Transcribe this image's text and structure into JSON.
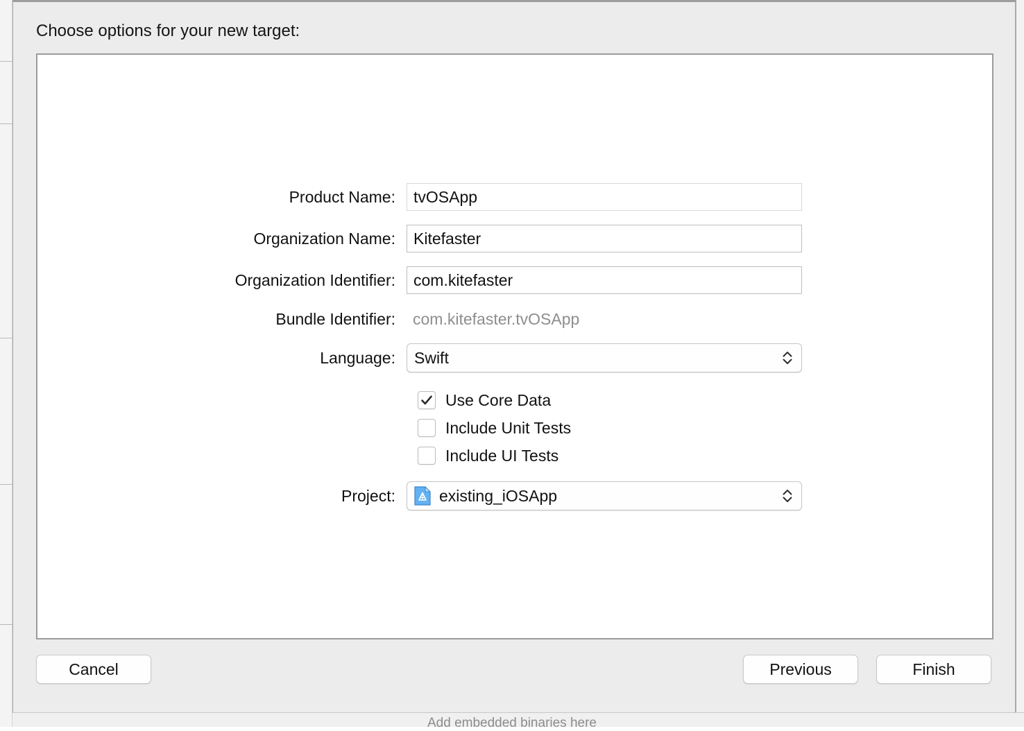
{
  "backdrop": {
    "hint_text": "Add embedded binaries here"
  },
  "sheet": {
    "title": "Choose options for your new target:",
    "fields": [
      {
        "label": "Product Name:",
        "value": "tvOSApp",
        "type": "text",
        "name": "product-name"
      },
      {
        "label": "Organization Name:",
        "value": "Kitefaster",
        "type": "text",
        "name": "organization-name"
      },
      {
        "label": "Organization Identifier:",
        "value": "com.kitefaster",
        "type": "text",
        "name": "organization-identifier"
      },
      {
        "label": "Bundle Identifier:",
        "value": "com.kitefaster.tvOSApp",
        "type": "static",
        "name": "bundle-identifier"
      },
      {
        "label": "Language:",
        "value": "Swift",
        "type": "popup",
        "name": "language"
      },
      {
        "label": "Project:",
        "value": "existing_iOSApp",
        "type": "popup-icon",
        "icon": "xcode-project-document-icon",
        "name": "project"
      }
    ],
    "checkboxes": [
      {
        "label": "Use Core Data",
        "checked": true,
        "name": "use-core-data"
      },
      {
        "label": "Include Unit Tests",
        "checked": false,
        "name": "include-unit-tests"
      },
      {
        "label": "Include UI Tests",
        "checked": false,
        "name": "include-ui-tests"
      }
    ],
    "buttons": {
      "cancel": "Cancel",
      "previous": "Previous",
      "finish": "Finish"
    }
  },
  "colors": {
    "sheet_background": "#ececec",
    "content_background": "#ffffff",
    "text": "#111111",
    "muted_text": "#8e8e8e",
    "field_border": "#bdbdbd",
    "pane_border": "#9b9b9b",
    "project_icon_blue": "#4ea6f0"
  }
}
